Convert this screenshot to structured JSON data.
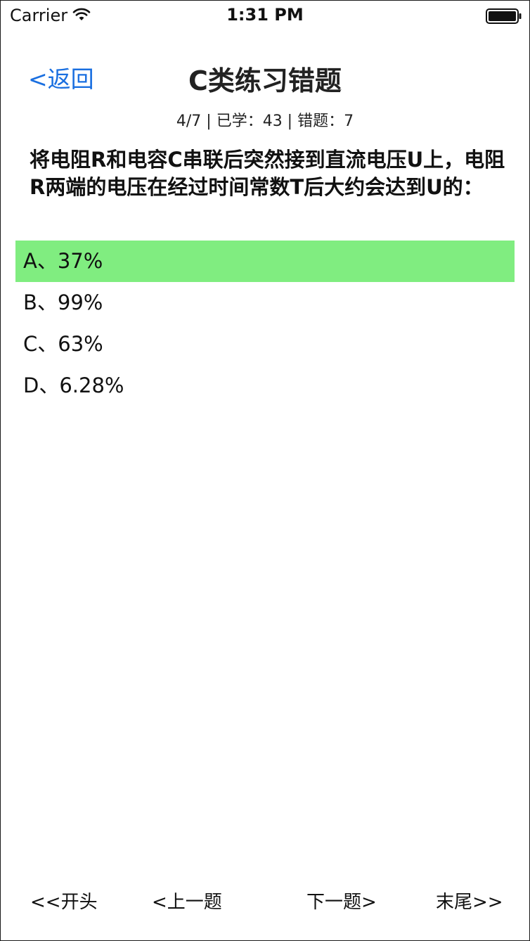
{
  "status_bar": {
    "carrier": "Carrier",
    "time": "1:31 PM",
    "icons": [
      "wifi-icon",
      "battery-icon"
    ]
  },
  "nav": {
    "back_label": "<返回",
    "title": "C类练习错题",
    "back_color": "#1a6fe0"
  },
  "progress": {
    "text": "4/7 | 已学：43 | 错题：7"
  },
  "question": {
    "text": "将电阻R和电容C串联后突然接到直流电压U上，电阻R两端的电压在经过时间常数T后大约会达到U的："
  },
  "options": [
    {
      "label": "A、37%",
      "highlighted": true
    },
    {
      "label": "B、99%",
      "highlighted": false
    },
    {
      "label": "C、63%",
      "highlighted": false
    },
    {
      "label": "D、6.28%",
      "highlighted": false
    }
  ],
  "highlight_color": "#80ed80",
  "toolbar": {
    "first_label": "<<开头",
    "prev_label": "<上一题",
    "next_label": "下一题>",
    "last_label": "末尾>>"
  }
}
